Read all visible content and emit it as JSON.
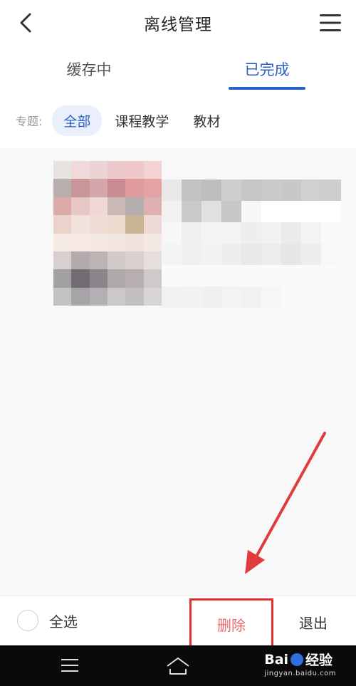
{
  "header": {
    "title": "离线管理",
    "back_icon": "chevron-left-icon",
    "menu_icon": "hamburger-menu-icon"
  },
  "tabs": [
    {
      "label": "缓存中",
      "active": false
    },
    {
      "label": "已完成",
      "active": true
    }
  ],
  "filters": {
    "label": "专题:",
    "options": [
      {
        "label": "全部",
        "active": true
      },
      {
        "label": "课程教学",
        "active": false
      },
      {
        "label": "教材",
        "active": false
      }
    ]
  },
  "action_bar": {
    "select_all_label": "全选",
    "delete_label": "删除",
    "exit_label": "退出"
  },
  "watermark": {
    "logo_left": "Bai",
    "logo_right": "经验",
    "url": "jingyan.baidu.com"
  },
  "colors": {
    "accent": "#2a5fc4",
    "delete_text": "#e86b6b",
    "highlight_box": "#e03131",
    "annotation_arrow": "#e03c3c"
  }
}
